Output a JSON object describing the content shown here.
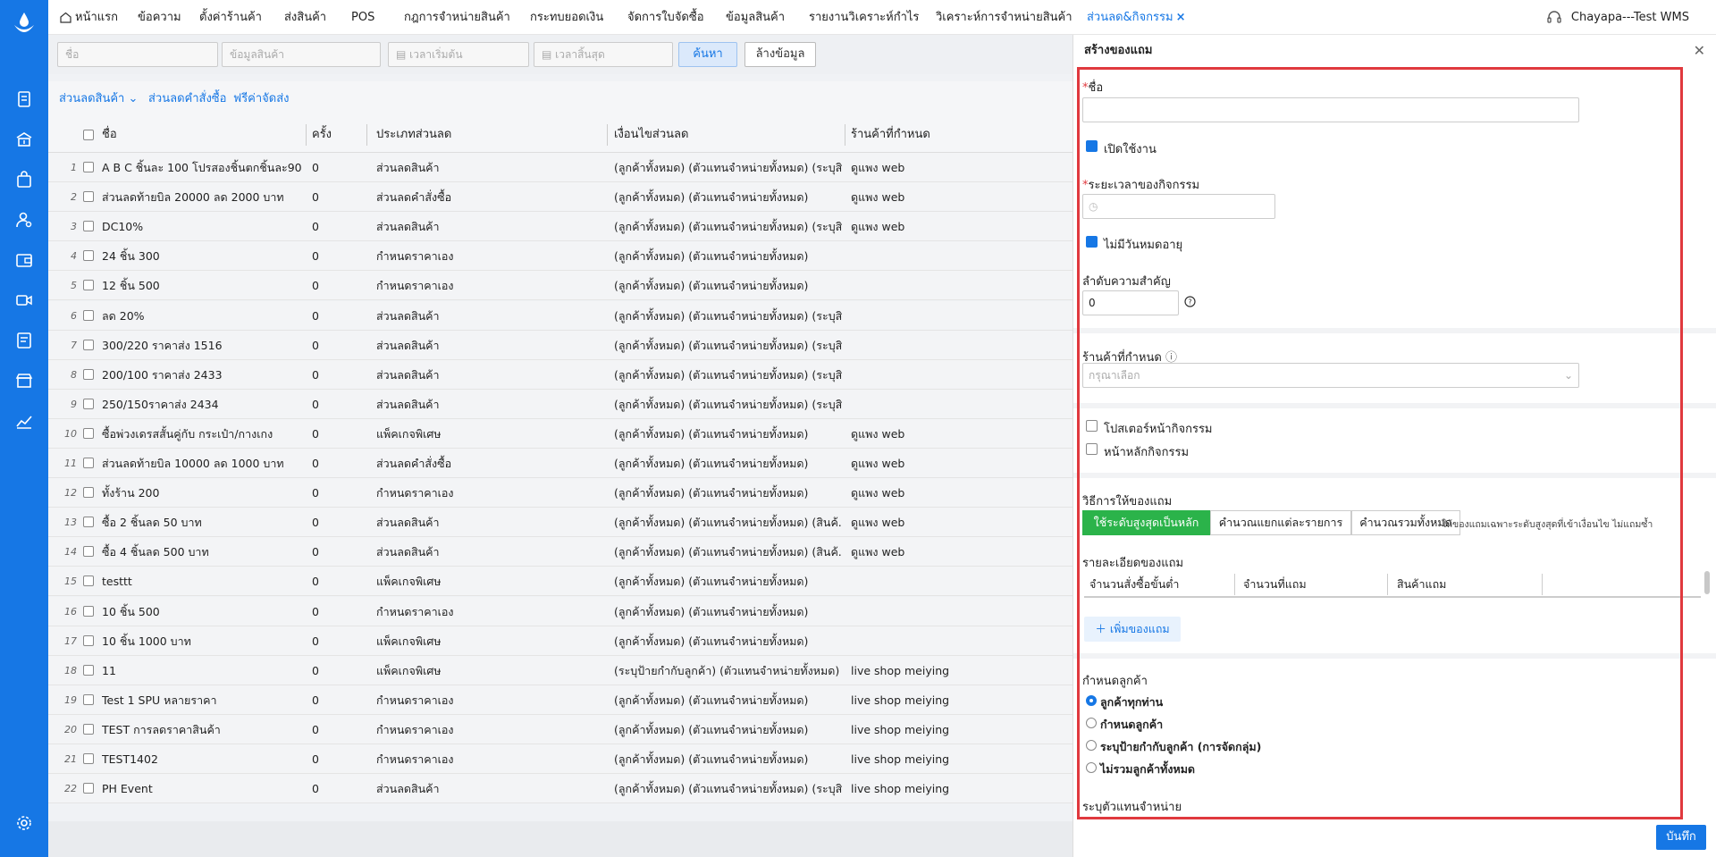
{
  "nav": {
    "tabs": [
      {
        "label": "หน้าแรก"
      },
      {
        "label": "ข้อความ"
      },
      {
        "label": "ตั้งค่าร้านค้า"
      },
      {
        "label": "ส่งสินค้า"
      },
      {
        "label": "POS"
      },
      {
        "label": "กฎการจำหน่ายสินค้า"
      },
      {
        "label": "กระทบยอดเงิน"
      },
      {
        "label": "จัดการใบจัดซื้อ"
      },
      {
        "label": "ข้อมูลสินค้า"
      },
      {
        "label": "รายงานวิเคราะห์กำไร"
      },
      {
        "label": "วิเคราะห์การจำหน่ายสินค้า"
      },
      {
        "label": "ส่วนลด&กิจกรรม"
      }
    ],
    "user": "Chayapa---Test WMS"
  },
  "search": {
    "name_placeholder": "ชื่อ",
    "product_placeholder": "ข้อมูลสินค้า",
    "start_placeholder": "เวลาเริ่มต้น",
    "end_placeholder": "เวลาสิ้นสุด",
    "search_label": "ค้นหา",
    "clear_label": "ล้างข้อมูล"
  },
  "filters": {
    "product_discount": "ส่วนลดสินค้า",
    "order_discount": "ส่วนลดคำสั่งซื้อ",
    "free_shipping": "ฟรีค่าจัดส่ง"
  },
  "table": {
    "headers": {
      "name": "ชื่อ",
      "times": "ครั้ง",
      "type": "ประเภทส่วนลด",
      "condition": "เงื่อนไขส่วนลด",
      "shop": "ร้านค้าที่กำหนด"
    },
    "rows": [
      {
        "no": "1",
        "name": "A B C ชิ้นละ 100 โปรสองชิ้นตกชิ้นละ90",
        "times": "0",
        "type": "ส่วนลดสินค้า",
        "condition": "(ลูกค้าทั้งหมด) (ตัวแทนจำหน่ายทั้งหมด) (ระบุสิ...",
        "shop": "ดูแพง web"
      },
      {
        "no": "2",
        "name": "ส่วนลดท้ายบิล 20000 ลด 2000 บาท",
        "times": "0",
        "type": "ส่วนลดคำสั่งซื้อ",
        "condition": "(ลูกค้าทั้งหมด) (ตัวแทนจำหน่ายทั้งหมด)",
        "shop": "ดูแพง web"
      },
      {
        "no": "3",
        "name": "DC10%",
        "times": "0",
        "type": "ส่วนลดสินค้า",
        "condition": "(ลูกค้าทั้งหมด) (ตัวแทนจำหน่ายทั้งหมด) (ระบุสิ...",
        "shop": "ดูแพง web"
      },
      {
        "no": "4",
        "name": "24 ชิ้น 300",
        "times": "0",
        "type": "กำหนดราคาเอง",
        "condition": "(ลูกค้าทั้งหมด) (ตัวแทนจำหน่ายทั้งหมด)",
        "shop": ""
      },
      {
        "no": "5",
        "name": "12 ชิ้น 500",
        "times": "0",
        "type": "กำหนดราคาเอง",
        "condition": "(ลูกค้าทั้งหมด) (ตัวแทนจำหน่ายทั้งหมด)",
        "shop": ""
      },
      {
        "no": "6",
        "name": "ลด 20%",
        "times": "0",
        "type": "ส่วนลดสินค้า",
        "condition": "(ลูกค้าทั้งหมด) (ตัวแทนจำหน่ายทั้งหมด) (ระบุสิ...",
        "shop": ""
      },
      {
        "no": "7",
        "name": "300/220 ราคาส่ง 1516",
        "times": "0",
        "type": "ส่วนลดสินค้า",
        "condition": "(ลูกค้าทั้งหมด) (ตัวแทนจำหน่ายทั้งหมด) (ระบุสิ...",
        "shop": ""
      },
      {
        "no": "8",
        "name": "200/100 ราคาส่ง 2433",
        "times": "0",
        "type": "ส่วนลดสินค้า",
        "condition": "(ลูกค้าทั้งหมด) (ตัวแทนจำหน่ายทั้งหมด) (ระบุสิ...",
        "shop": ""
      },
      {
        "no": "9",
        "name": "250/150ราคาส่ง 2434",
        "times": "0",
        "type": "ส่วนลดสินค้า",
        "condition": "(ลูกค้าทั้งหมด) (ตัวแทนจำหน่ายทั้งหมด) (ระบุสิ...",
        "shop": ""
      },
      {
        "no": "10",
        "name": "ซื้อพ่วงเดรสสั้นคู่กับ กระเป๋า/กางเกง",
        "times": "0",
        "type": "แพ็คเกจพิเศษ",
        "condition": "(ลูกค้าทั้งหมด) (ตัวแทนจำหน่ายทั้งหมด)",
        "shop": "ดูแพง web"
      },
      {
        "no": "11",
        "name": "ส่วนลดท้ายบิล 10000 ลด 1000 บาท",
        "times": "0",
        "type": "ส่วนลดคำสั่งซื้อ",
        "condition": "(ลูกค้าทั้งหมด) (ตัวแทนจำหน่ายทั้งหมด)",
        "shop": "ดูแพง web"
      },
      {
        "no": "12",
        "name": "ทั้งร้าน 200",
        "times": "0",
        "type": "กำหนดราคาเอง",
        "condition": "(ลูกค้าทั้งหมด) (ตัวแทนจำหน่ายทั้งหมด)",
        "shop": "ดูแพง web"
      },
      {
        "no": "13",
        "name": "ซื้อ 2 ชิ้นลด 50 บาท",
        "times": "0",
        "type": "ส่วนลดสินค้า",
        "condition": "(ลูกค้าทั้งหมด) (ตัวแทนจำหน่ายทั้งหมด) (สินค้...",
        "shop": "ดูแพง web"
      },
      {
        "no": "14",
        "name": "ซื้อ 4 ชิ้นลด 500 บาท",
        "times": "0",
        "type": "ส่วนลดสินค้า",
        "condition": "(ลูกค้าทั้งหมด) (ตัวแทนจำหน่ายทั้งหมด) (สินค้...",
        "shop": "ดูแพง web"
      },
      {
        "no": "15",
        "name": "testtt",
        "times": "0",
        "type": "แพ็คเกจพิเศษ",
        "condition": "(ลูกค้าทั้งหมด) (ตัวแทนจำหน่ายทั้งหมด)",
        "shop": ""
      },
      {
        "no": "16",
        "name": "10 ชิ้น 500",
        "times": "0",
        "type": "กำหนดราคาเอง",
        "condition": "(ลูกค้าทั้งหมด) (ตัวแทนจำหน่ายทั้งหมด)",
        "shop": ""
      },
      {
        "no": "17",
        "name": "10 ชิ้น 1000 บาท",
        "times": "0",
        "type": "แพ็คเกจพิเศษ",
        "condition": "(ลูกค้าทั้งหมด) (ตัวแทนจำหน่ายทั้งหมด)",
        "shop": ""
      },
      {
        "no": "18",
        "name": "11",
        "times": "0",
        "type": "แพ็คเกจพิเศษ",
        "condition": "(ระบุป้ายกำกับลูกค้า) (ตัวแทนจำหน่ายทั้งหมด)",
        "shop": "live shop meiying"
      },
      {
        "no": "19",
        "name": "Test 1 SPU หลายราคา",
        "times": "0",
        "type": "กำหนดราคาเอง",
        "condition": "(ลูกค้าทั้งหมด) (ตัวแทนจำหน่ายทั้งหมด)",
        "shop": "live shop meiying"
      },
      {
        "no": "20",
        "name": "TEST การลดราคาสินค้า",
        "times": "0",
        "type": "กำหนดราคาเอง",
        "condition": "(ลูกค้าทั้งหมด) (ตัวแทนจำหน่ายทั้งหมด)",
        "shop": "live shop meiying"
      },
      {
        "no": "21",
        "name": "TEST1402",
        "times": "0",
        "type": "กำหนดราคาเอง",
        "condition": "(ลูกค้าทั้งหมด) (ตัวแทนจำหน่ายทั้งหมด)",
        "shop": "live shop meiying"
      },
      {
        "no": "22",
        "name": "PH Event",
        "times": "0",
        "type": "ส่วนลดสินค้า",
        "condition": "(ลูกค้าทั้งหมด) (ตัวแทนจำหน่ายทั้งหมด) (ระบุสิ...",
        "shop": "live shop meiying"
      }
    ]
  },
  "panel": {
    "title": "สร้างของแถม",
    "name_label": "ชื่อ",
    "enable_label": "เปิดใช้งาน",
    "period_label": "ระยะเวลาของกิจกรรม",
    "no_expiry_label": "ไม่มีวันหมดอายุ",
    "priority_label": "ลำดับความสำคัญ",
    "priority_value": "0",
    "shop_label": "ร้านค้าที่กำหนด",
    "shop_placeholder": "กรุณาเลือก",
    "poster_label": "โปสเตอร์หน้ากิจกรรม",
    "main_page_label": "หน้าหลักกิจกรรม",
    "gift_method_label": "วิธีการให้ของแถม",
    "method_options": [
      "ใช้ระดับสูงสุดเป็นหลัก",
      "คำนวณแยกแต่ละรายการ",
      "คำนวณรวมทั้งหมด"
    ],
    "method_hint": "ให้ของแถมเฉพาะระดับสูงสุดที่เข้าเงื่อนไข ไม่แถมซ้ำ",
    "gift_detail_label": "รายละเอียดของแถม",
    "gift_headers": [
      "จำนวนสั่งซื้อขั้นต่ำ",
      "จำนวนที่แถม",
      "สินค้าแถม"
    ],
    "add_gift_label": "เพิ่มของแถม",
    "customer_label": "กำหนดลูกค้า",
    "customer_options": [
      "ลูกค้าทุกท่าน",
      "กำหนดลูกค้า",
      "ระบุป้ายกำกับลูกค้า (การจัดกลุ่ม)",
      "ไม่รวมลูกค้าทั้งหมด"
    ],
    "agent_label": "ระบุตัวแทนจำหน่าย",
    "save_label": "บันทึก"
  },
  "colors": {
    "primary": "#1677e5",
    "highlight": "#e0393e",
    "green": "#2bb34a"
  }
}
